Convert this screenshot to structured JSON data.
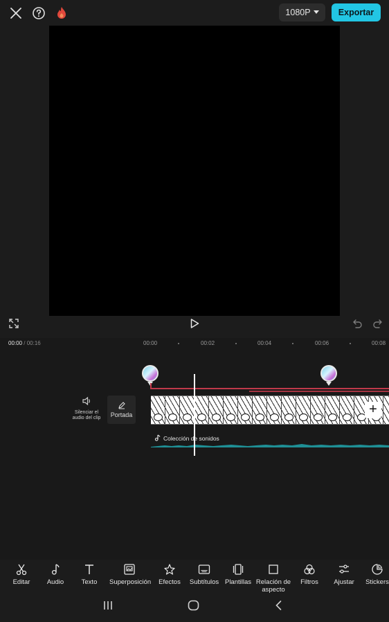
{
  "topbar": {
    "close_icon": "close-icon",
    "help_icon": "help-circle-icon",
    "pro_icon": "flame-icon",
    "resolution": "1080P",
    "export_label": "Exportar",
    "accent": "#22c6e4",
    "flame_color": "#e0473b"
  },
  "player": {
    "fullscreen_icon": "fullscreen-icon",
    "play_icon": "play-icon",
    "undo_icon": "undo-icon",
    "redo_icon": "redo-icon"
  },
  "timeline": {
    "current_time": "00:00",
    "total_time": "/ 00:16",
    "ruler": [
      "00:00",
      "00:02",
      "00:04",
      "00:06",
      "00:08"
    ],
    "mute_label": "Silenciar el audio del clip",
    "cover_label": "Portada",
    "audio_track_label": "Colección de sonidos",
    "red_line_color": "#c0394a",
    "wave_color": "#1f8f95"
  },
  "toolbar": {
    "items": [
      {
        "label": "Editar",
        "icon": "scissors-icon"
      },
      {
        "label": "Audio",
        "icon": "music-note-icon"
      },
      {
        "label": "Texto",
        "icon": "text-icon"
      },
      {
        "label": "Superposición",
        "icon": "overlay-icon"
      },
      {
        "label": "Efectos",
        "icon": "effects-star-icon"
      },
      {
        "label": "Subtítulos",
        "icon": "subtitles-icon"
      },
      {
        "label": "Plantillas",
        "icon": "templates-icon"
      },
      {
        "label": "Relación de aspecto",
        "icon": "aspect-ratio-icon"
      },
      {
        "label": "Filtros",
        "icon": "filters-icon"
      },
      {
        "label": "Ajustar",
        "icon": "adjust-sliders-icon"
      },
      {
        "label": "Stickers",
        "icon": "sticker-icon"
      }
    ]
  },
  "android_nav": {
    "recents_icon": "recents-icon",
    "home_icon": "home-icon",
    "back_icon": "back-icon"
  }
}
